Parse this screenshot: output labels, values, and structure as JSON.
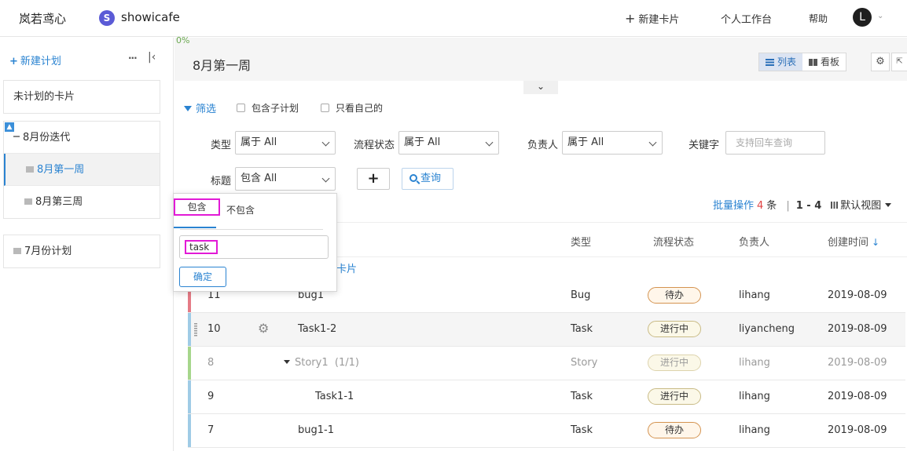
{
  "topbar": {
    "org": "岚若鸢心",
    "project_initial": "S",
    "project": "showicafe",
    "new_card": "新建卡片",
    "workspace": "个人工作台",
    "help": "帮助",
    "avatar": "L"
  },
  "sidebar": {
    "new_plan": "新建计划",
    "more": "···",
    "unplanned": "未计划的卡片",
    "group": "8月份迭代",
    "items": [
      "8月第一周",
      "8月第三周"
    ],
    "other": "7月份计划"
  },
  "main": {
    "progress": "0%",
    "title": "8月第一周",
    "view_list": "列表",
    "view_board": "看板"
  },
  "filters": {
    "toggle": "筛选",
    "include_sub": "包含子计划",
    "only_mine": "只看自己的",
    "type_label": "类型",
    "type_value": "属于 All",
    "status_label": "流程状态",
    "status_value": "属于 All",
    "owner_label": "负责人",
    "owner_value": "属于 All",
    "keyword_label": "关键字",
    "keyword_placeholder": "支持回车查询",
    "title_label": "标题",
    "title_value": "包含 All",
    "query": "查询"
  },
  "batch": {
    "label": "批量操作",
    "count": "4",
    "unit": "条",
    "separator": "|",
    "range": "1 - 4",
    "default_view": "默认视图"
  },
  "table": {
    "headers": {
      "type": "类型",
      "status": "流程状态",
      "owner": "负责人",
      "created": "创建时间"
    },
    "section": "卡片",
    "rows": [
      {
        "id": "11",
        "title": "bug1",
        "type": "Bug",
        "status": "待办",
        "owner": "lihang",
        "created": "2019-08-09",
        "color": "#e57b86"
      },
      {
        "id": "10",
        "title": "Task1-2",
        "type": "Task",
        "status": "进行中",
        "owner": "liyancheng",
        "created": "2019-08-09",
        "color": "#9fcbe6"
      },
      {
        "id": "8",
        "title": "Story1",
        "progress": "(1/1)",
        "type": "Story",
        "status": "进行中",
        "owner": "lihang",
        "created": "2019-08-09",
        "color": "#a6d68c"
      },
      {
        "id": "9",
        "title": "Task1-1",
        "type": "Task",
        "status": "进行中",
        "owner": "lihang",
        "created": "2019-08-09",
        "color": "#9fcbe6"
      },
      {
        "id": "7",
        "title": "bug1-1",
        "type": "Task",
        "status": "待办",
        "owner": "lihang",
        "created": "2019-08-09",
        "color": "#9fcbe6"
      }
    ]
  },
  "popup": {
    "tab_include": "包含",
    "tab_exclude": "不包含",
    "input_value": "task",
    "confirm": "确定"
  }
}
